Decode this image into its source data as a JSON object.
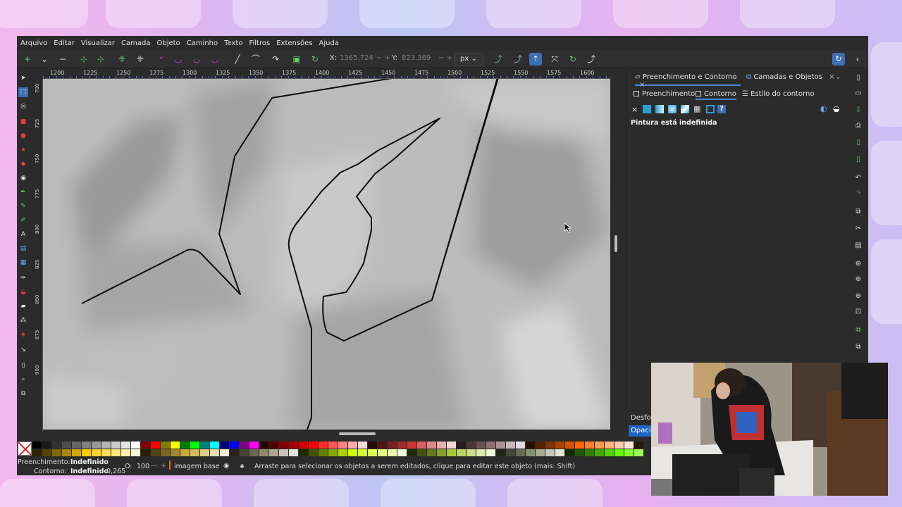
{
  "menu": [
    "Arquivo",
    "Editar",
    "Visualizar",
    "Camada",
    "Objeto",
    "Caminho",
    "Texto",
    "Filtros",
    "Extensões",
    "Ajuda"
  ],
  "toolbar": {
    "x_label": "X:",
    "x_value": "1365,724",
    "y_label": "Y:",
    "y_value": "823,369",
    "unit": "px",
    "unit_caret": "⌄"
  },
  "ruler": {
    "top_labels": [
      "1200",
      "1225",
      "1250",
      "1275",
      "1300",
      "1325",
      "1350",
      "1375",
      "1400",
      "1425",
      "1450",
      "1475",
      "1500",
      "1525",
      "1550",
      "1575",
      "1600"
    ],
    "left_labels": [
      "700",
      "725",
      "750",
      "775",
      "800",
      "825",
      "850",
      "875",
      "900"
    ]
  },
  "dock": {
    "tab1": "Preenchimento e Contorno",
    "tab2": "Camadas e Objetos",
    "close": "×",
    "subtabs": {
      "fill": "Preenchimento",
      "stroke": "Contorno",
      "style": "Estilo do contorno"
    },
    "paint_unset": "×",
    "paint_help": "?",
    "message": "Pintura está indefinida",
    "blur": "Desfoq",
    "opacity": "Opacid"
  },
  "status": {
    "fill_label": "Preenchimento:",
    "fill_value": "Indefinido",
    "stroke_label": "Contorno:",
    "stroke_value": "Indefinido",
    "stroke_width": "0,265",
    "opacity_label": "O:",
    "opacity_value": "100",
    "opacity_minus": "—",
    "opacity_plus": "+",
    "layer": "imagem base",
    "hint": "Arraste para selecionar os objetos a serem editados, clique para editar este objeto (mais: Shift)"
  },
  "colors": {
    "accent": "#4a86d6",
    "opacity_field": "#1d64c5",
    "node_tools": "#5fcf6e",
    "bezier_tools": "#e040c8",
    "palette_row1": [
      "#000000",
      "#1a1a1a",
      "#333333",
      "#4d4d4d",
      "#666666",
      "#808080",
      "#999999",
      "#b3b3b3",
      "#cccccc",
      "#e6e6e6",
      "#ffffff",
      "#800000",
      "#ff0000",
      "#808000",
      "#ffff00",
      "#008000",
      "#00ff00",
      "#008080",
      "#00ffff",
      "#000080",
      "#0000ff",
      "#800080",
      "#ff00ff",
      "#2b0000",
      "#550000",
      "#800000",
      "#aa0000",
      "#d40000",
      "#ff0000",
      "#ff2a2a",
      "#ff5555",
      "#ff8080",
      "#ffaaaa",
      "#ffd5d5",
      "#280b0b",
      "#501616",
      "#782121",
      "#a02c2c",
      "#c83737",
      "#d35f5f",
      "#de8787",
      "#e9afaf",
      "#f4d7d7",
      "#241c1c",
      "#483737",
      "#6c5353",
      "#916f6f",
      "#ac9393",
      "#c8b7b7",
      "#e3dbdb",
      "#2b1100",
      "#552200",
      "#803300",
      "#aa4400",
      "#d45500",
      "#ff6600",
      "#ff7f2a",
      "#ff9955",
      "#ffb380",
      "#ffccaa",
      "#ffe6d5",
      "#281a0b"
    ],
    "palette_row2": [
      "#2b2200",
      "#554400",
      "#806600",
      "#aa8800",
      "#d4aa00",
      "#ffcc00",
      "#ffd42a",
      "#ffdd55",
      "#ffe680",
      "#ffeeaa",
      "#fff6d5",
      "#28220b",
      "#504416",
      "#786721",
      "#a0892c",
      "#c8ab37",
      "#d3bc5f",
      "#decd87",
      "#e9ddaf",
      "#f4eed7",
      "#24221c",
      "#484537",
      "#6c6753",
      "#918a6f",
      "#aca793",
      "#c8c4b7",
      "#e3e2db",
      "#222b00",
      "#445500",
      "#668000",
      "#88aa00",
      "#aad400",
      "#ccff00",
      "#d4ff2a",
      "#ddff55",
      "#e5ff80",
      "#eeffaa",
      "#f6ffd5",
      "#22280b",
      "#445016",
      "#677821",
      "#89a02c",
      "#abc837",
      "#bcd35f",
      "#cdde87",
      "#dde9af",
      "#eef4d7",
      "#222419",
      "#444837",
      "#666c53",
      "#88916f",
      "#a7ac93",
      "#c4c8b7",
      "#e2e3db",
      "#112b00",
      "#225500",
      "#338000",
      "#44aa00",
      "#55d400",
      "#66ff00",
      "#7fff2a",
      "#99ff55"
    ]
  }
}
